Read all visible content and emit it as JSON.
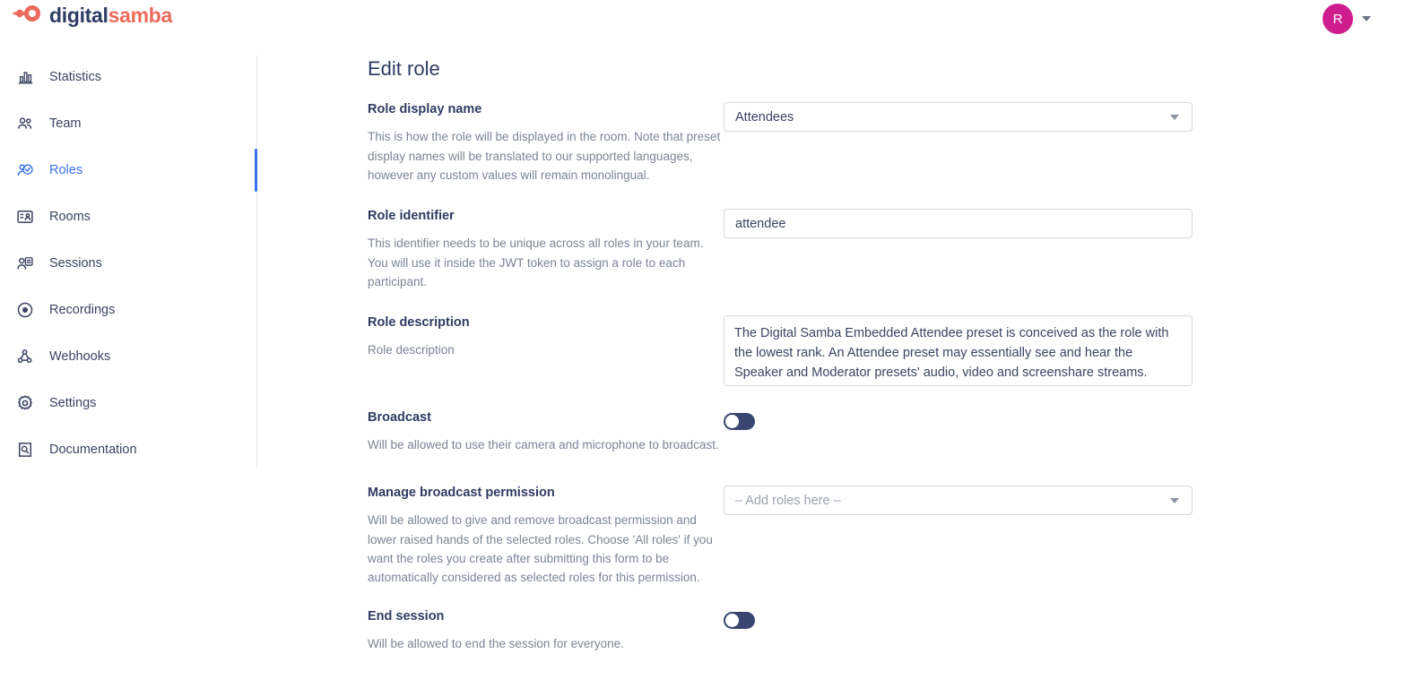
{
  "brand": {
    "name_part1": "digital",
    "name_part2": "samba",
    "logo_icon": "samba-node-logo-icon",
    "accent_coral": "#ec6a5c",
    "accent_navy": "#2f3c63",
    "accent_blue": "#3a72e8",
    "avatar_color": "#ce1d8d"
  },
  "topbar": {
    "avatar_initial": "R",
    "avatar_caret_icon": "chevron-down-icon"
  },
  "sidebar": {
    "items": [
      {
        "label": "Statistics",
        "icon": "bar-chart-icon",
        "active": false
      },
      {
        "label": "Team",
        "icon": "people-icon",
        "active": false
      },
      {
        "label": "Roles",
        "icon": "person-check-icon",
        "active": true
      },
      {
        "label": "Rooms",
        "icon": "id-card-icon",
        "active": false
      },
      {
        "label": "Sessions",
        "icon": "person-list-icon",
        "active": false
      },
      {
        "label": "Recordings",
        "icon": "record-dot-icon",
        "active": false
      },
      {
        "label": "Webhooks",
        "icon": "webhook-icon",
        "active": false
      },
      {
        "label": "Settings",
        "icon": "gear-icon",
        "active": false
      },
      {
        "label": "Documentation",
        "icon": "doc-search-icon",
        "active": false
      }
    ]
  },
  "main": {
    "page_title": "Edit role",
    "fields": {
      "role_display_name": {
        "label": "Role display name",
        "help": "This is how the role will be displayed in the room. Note that preset display names will be translated to our supported languages, however any custom values will remain monolingual.",
        "value": "Attendees",
        "caret_icon": "chevron-down-icon"
      },
      "role_identifier": {
        "label": "Role identifier",
        "help": "This identifier needs to be unique across all roles in your team. You will use it inside the JWT token to assign a role to each participant.",
        "value": "attendee",
        "placeholder": "Role identifier"
      },
      "role_description": {
        "label": "Role description",
        "help": "Role description",
        "value": "The Digital Samba Embedded Attendee preset is conceived as the role with the lowest rank. An Attendee preset may essentially see and hear the Speaker and Moderator presets' audio, video and screenshare streams.",
        "placeholder": "Role description"
      },
      "broadcast": {
        "label": "Broadcast",
        "help": "Will be allowed to use their camera and microphone to broadcast.",
        "enabled": false
      },
      "manage_broadcast_permission": {
        "label": "Manage broadcast permission",
        "help": "Will be allowed to give and remove broadcast permission and lower raised hands of the selected roles. Choose 'All roles' if you want the roles you create after submitting this form to be automatically considered as selected roles for this permission.",
        "placeholder": "– Add roles here –",
        "caret_icon": "chevron-down-icon"
      },
      "end_session": {
        "label": "End session",
        "help": "Will be allowed to end the session for everyone.",
        "enabled": false
      }
    }
  }
}
